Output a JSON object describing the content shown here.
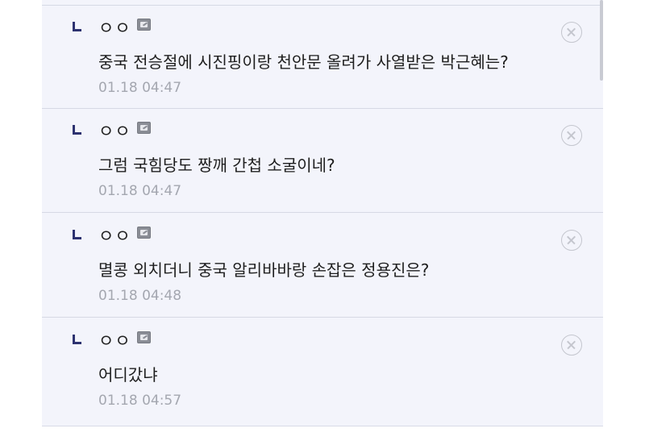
{
  "comments": [
    {
      "nickname": "ㅇㅇ",
      "text": "중국 전승절에 시진핑이랑 천안문 올려가 사열받은 박근혜는?",
      "time": "01.18 04:47",
      "icon": "edit-icon"
    },
    {
      "nickname": "ㅇㅇ",
      "text": "그럼 국힘당도 짱깨 간첩 소굴이네?",
      "time": "01.18 04:47",
      "icon": "edit-icon"
    },
    {
      "nickname": "ㅇㅇ",
      "text": "멸콩 외치더니 중국 알리바바랑 손잡은 정용진은?",
      "time": "01.18 04:48",
      "icon": "edit-icon"
    },
    {
      "nickname": "ㅇㅇ",
      "text": "어디갔냐",
      "time": "01.18 04:57",
      "icon": "edit-icon"
    }
  ],
  "colors": {
    "list_background": "#f3f4fb",
    "reply_mark": "#2d3270",
    "time_text": "#a4a7b0",
    "delete_icon": "#c4c6ce"
  }
}
